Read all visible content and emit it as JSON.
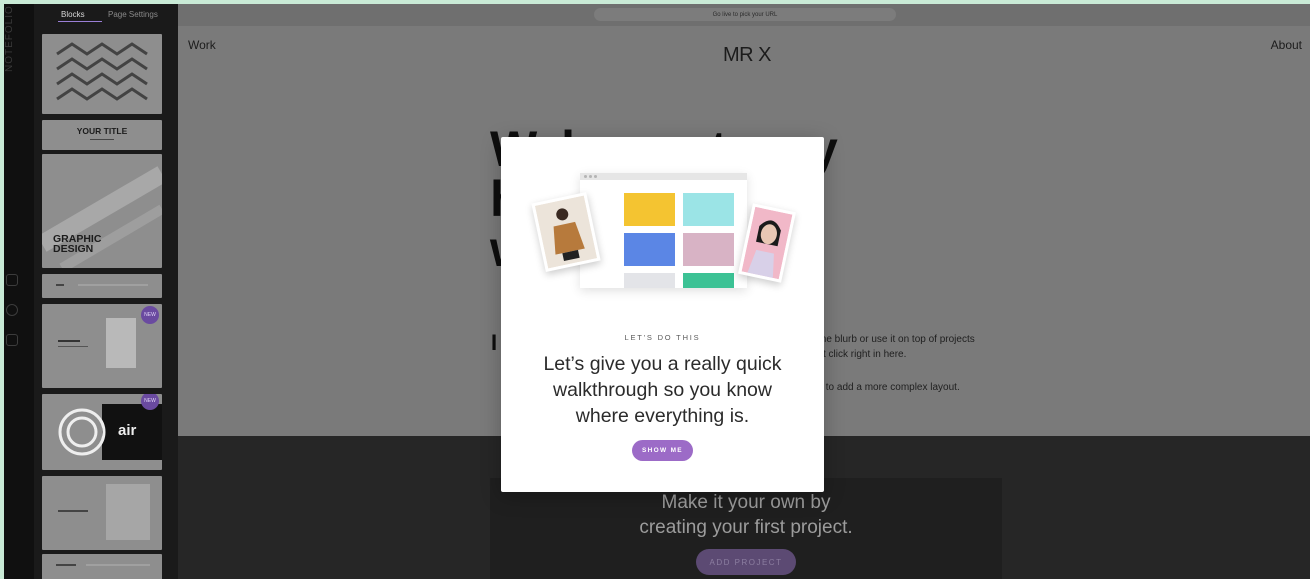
{
  "panel": {
    "tabs": [
      "Blocks",
      "Page Settings"
    ],
    "rail_brand": "NOTEFOLIO",
    "thumbs": [
      {
        "text": ""
      },
      {
        "text": "YOUR TITLE"
      },
      {
        "text": "GRAPHIC DESIGN"
      },
      {
        "text": ""
      },
      {
        "text": "",
        "badge": "NEW"
      },
      {
        "text": "air",
        "badge": "NEW"
      },
      {
        "text": ""
      },
      {
        "text": ""
      }
    ]
  },
  "editor": {
    "url_hint": "Go live to pick your URL"
  },
  "site": {
    "nav_left": "Work",
    "nav_right": "About",
    "logo": "MR X",
    "hero_lines": [
      "Welcome to my",
      "hand-selected",
      "work area"
    ],
    "body_i": "I",
    "body_lines": [
      "me blurb or use it on top of projects",
      "st click right in here.",
      "",
      "k to add a more complex layout."
    ],
    "cta_title_lines": [
      "Make it your own by",
      "creating your first project."
    ],
    "cta_button": "ADD PROJECT"
  },
  "modal": {
    "eyebrow": "LET'S DO THIS",
    "headline_lines": [
      "Let’s give you a really quick",
      "walkthrough so you know",
      "where everything is."
    ],
    "button": "SHOW ME",
    "tile_colors": [
      "#f4c431",
      "#9be4e6",
      "#5b86e5",
      "#d8b3c5",
      "#e3e4e8",
      "#3cc295"
    ]
  },
  "colors": {
    "accent": "#9c6bc7"
  }
}
